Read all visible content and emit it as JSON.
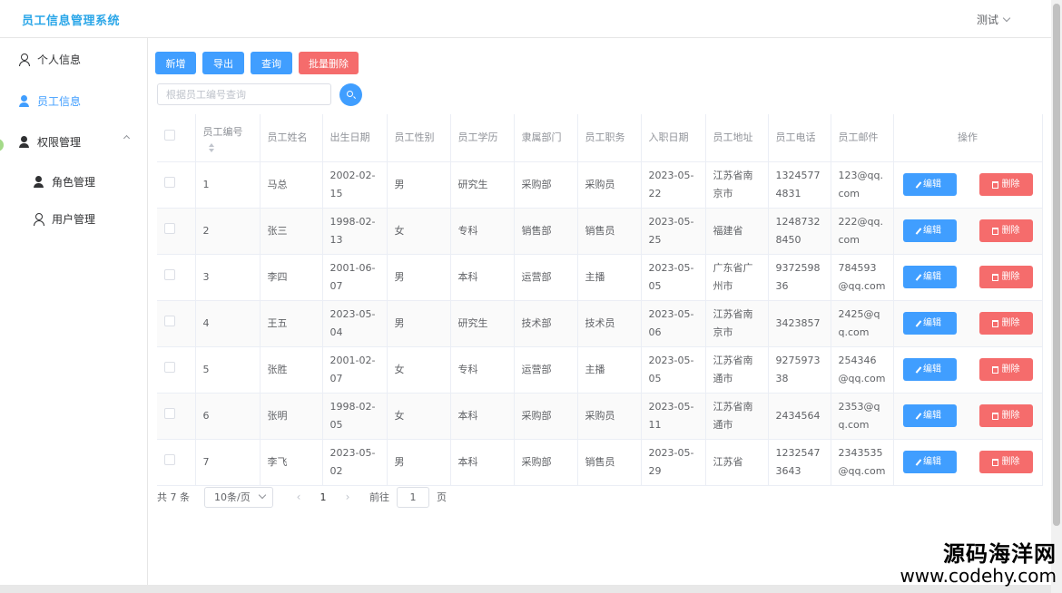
{
  "app": {
    "title": "员工信息管理系统"
  },
  "header": {
    "user": "测试"
  },
  "sidebar": {
    "items": [
      {
        "label": "个人信息",
        "icon": "user-outline-icon"
      },
      {
        "label": "员工信息",
        "icon": "user-solid-icon",
        "active": true
      },
      {
        "label": "权限管理",
        "icon": "user-solid-icon"
      },
      {
        "label": "角色管理",
        "icon": "user-solid-icon"
      },
      {
        "label": "用户管理",
        "icon": "user-outline-icon"
      }
    ]
  },
  "toolbar": {
    "add": "新增",
    "export": "导出",
    "query": "查询",
    "batch_delete": "批量删除"
  },
  "search": {
    "placeholder": "根据员工编号查询"
  },
  "table": {
    "headers": [
      "员工编号",
      "员工姓名",
      "出生日期",
      "员工性别",
      "员工学历",
      "隶属部门",
      "员工职务",
      "入职日期",
      "员工地址",
      "员工电话",
      "员工邮件",
      "操作"
    ],
    "rows": [
      [
        "1",
        "马总",
        "2002-02-15",
        "男",
        "研究生",
        "采购部",
        "采购员",
        "2023-05-22",
        "江苏省南京市",
        "13245774831",
        "123@qq.com"
      ],
      [
        "2",
        "张三",
        "1998-02-13",
        "女",
        "专科",
        "销售部",
        "销售员",
        "2023-05-25",
        "福建省",
        "12487328450",
        "222@qq.com"
      ],
      [
        "3",
        "李四",
        "2001-06-07",
        "男",
        "本科",
        "运营部",
        "主播",
        "2023-05-05",
        "广东省广州市",
        "937259836",
        "784593@qq.com"
      ],
      [
        "4",
        "王五",
        "2023-05-04",
        "男",
        "研究生",
        "技术部",
        "技术员",
        "2023-05-06",
        "江苏省南京市",
        "3423857",
        "2425@qq.com"
      ],
      [
        "5",
        "张胜",
        "2001-02-07",
        "女",
        "专科",
        "运营部",
        "主播",
        "2023-05-05",
        "江苏省南通市",
        "927597338",
        "254346@qq.com"
      ],
      [
        "6",
        "张明",
        "1998-02-05",
        "女",
        "本科",
        "采购部",
        "采购员",
        "2023-05-11",
        "江苏省南通市",
        "2434564",
        "2353@qq.com"
      ],
      [
        "7",
        "李飞",
        "2023-05-02",
        "男",
        "本科",
        "采购部",
        "销售员",
        "2023-05-29",
        "江苏省",
        "12325473643",
        "2343535@qq.com"
      ]
    ],
    "edit_label": "编辑",
    "delete_label": "删除"
  },
  "pagination": {
    "total": "共 7 条",
    "page_size": "10条/页",
    "current_page": "1",
    "goto_label": "前往",
    "goto_value": "1",
    "page_suffix": "页"
  },
  "watermark": {
    "cn": "源码海洋网",
    "url": "www.codehy.com"
  },
  "colors": {
    "primary": "#409eff",
    "danger": "#f56c6c",
    "brand": "#2aa6e8"
  }
}
